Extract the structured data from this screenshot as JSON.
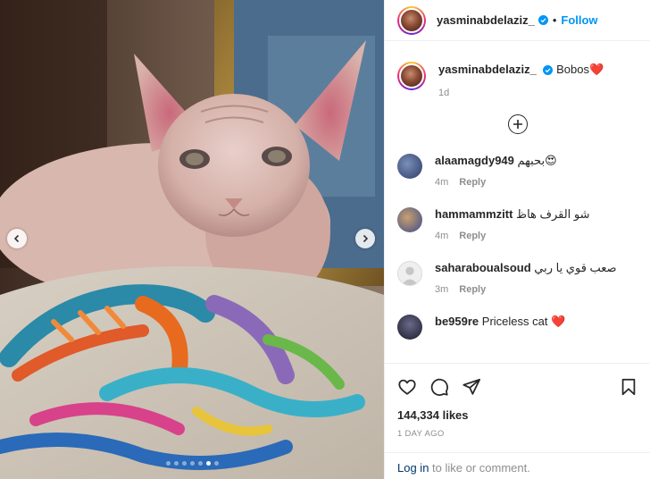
{
  "post": {
    "username": "yasminabdelaziz_",
    "follow_label": "Follow",
    "separator": "•",
    "caption_text": "Bobos",
    "caption_emoji": "❤️",
    "caption_time": "1d",
    "likes": "144,334 likes",
    "date": "1 DAY AGO"
  },
  "comments": [
    {
      "username": "alaamagdy949",
      "text": "بحبهم😍",
      "time": "4m",
      "reply": "Reply"
    },
    {
      "username": "hammammzitt",
      "text": "شو القرف هاظ",
      "time": "4m",
      "reply": "Reply"
    },
    {
      "username": "saharaboualsoud",
      "text": "صعب قوي يا ربي",
      "time": "3m",
      "reply": "Reply"
    },
    {
      "username": "be959re",
      "text": "Priceless cat ❤️",
      "time": "",
      "reply": ""
    }
  ],
  "footer": {
    "login_link": "Log in",
    "login_rest": " to like or comment."
  },
  "carousel": {
    "count": 7,
    "active_index": 5
  },
  "colors": {
    "accent": "#0095f6",
    "verified": "#0095f6",
    "heart": "#ed1c24"
  }
}
